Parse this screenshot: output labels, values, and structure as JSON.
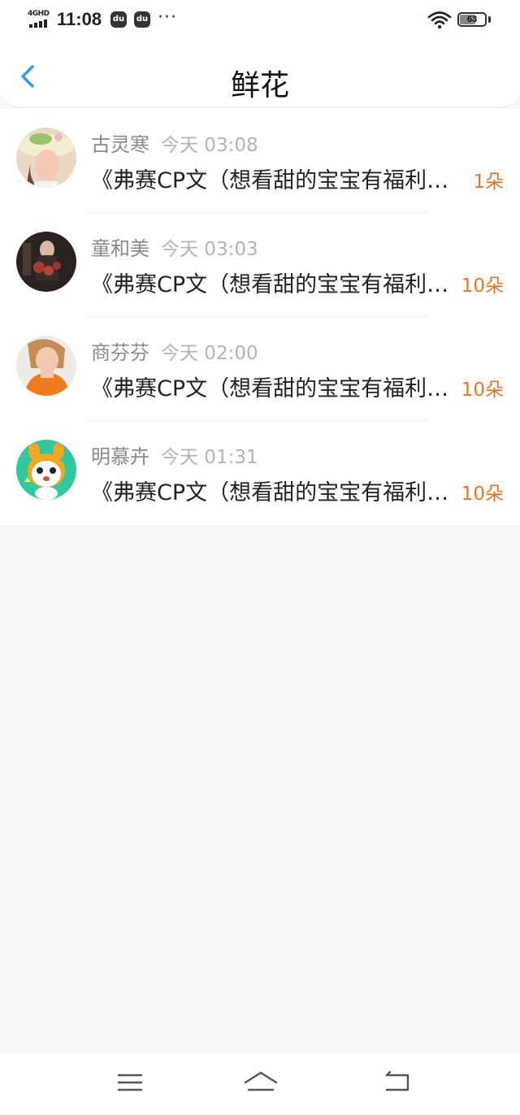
{
  "status_bar": {
    "network": "4GHD",
    "time": "11:08",
    "apps": [
      "du",
      "du"
    ],
    "more": "···",
    "battery": "63",
    "icons": [
      "signal-icon",
      "wifi-icon",
      "battery-icon"
    ]
  },
  "header": {
    "title": "鲜花",
    "back_icon": "chevron-left-icon"
  },
  "items": [
    {
      "name": "古灵寒",
      "time": "今天 03:08",
      "message": "《弗赛CP文（想看甜的宝宝有福利了）》",
      "count": "1朵"
    },
    {
      "name": "童和美",
      "time": "今天 03:03",
      "message": "《弗赛CP文（想看甜的宝宝有福利了）》",
      "count": "10朵"
    },
    {
      "name": "商芬芬",
      "time": "今天 02:00",
      "message": "《弗赛CP文（想看甜的宝宝有福利了）》",
      "count": "10朵"
    },
    {
      "name": "明慕卉",
      "time": "今天 01:31",
      "message": "《弗赛CP文（想看甜的宝宝有福利了）》",
      "count": "10朵"
    }
  ],
  "navbar": {
    "icons": [
      "menu-icon",
      "home-icon",
      "back-icon"
    ]
  },
  "colors": {
    "accent": "#2a9cf0",
    "count": "#e8742a",
    "background": "#f7f5f6"
  }
}
